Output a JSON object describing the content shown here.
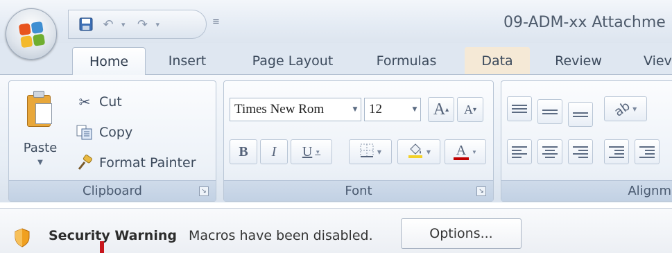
{
  "window": {
    "title": "09-ADM-xx Attachme"
  },
  "qat": {
    "icons": [
      "save-icon",
      "undo-icon",
      "redo-icon",
      "customize-qat-icon"
    ]
  },
  "tabs": [
    {
      "label": "Home",
      "active": true
    },
    {
      "label": "Insert"
    },
    {
      "label": "Page Layout"
    },
    {
      "label": "Formulas"
    },
    {
      "label": "Data",
      "highlighted": true
    },
    {
      "label": "Review"
    },
    {
      "label": "Viev"
    }
  ],
  "clipboard": {
    "paste_label": "Paste",
    "cut_label": "Cut",
    "copy_label": "Copy",
    "format_painter_label": "Format Painter",
    "group_label": "Clipboard"
  },
  "font": {
    "font_name": "Times New Rom",
    "font_size": "12",
    "grow_label": "A",
    "shrink_label": "A",
    "bold_label": "B",
    "italic_label": "I",
    "underline_label": "U",
    "font_color_label": "A",
    "group_label": "Font"
  },
  "alignment": {
    "group_label": "Alignm"
  },
  "security_bar": {
    "title": "Security Warning",
    "message": "Macros have been disabled.",
    "options_label": "Options..."
  },
  "colors": {
    "ribbon_bg": "#e6edf5",
    "group_label_bg": "#c2d1e4",
    "font_color_underline": "#c00000",
    "fill_color_underline": "#f2d12a",
    "shield": "#f0a020",
    "cursor_mark": "#c8161d"
  }
}
